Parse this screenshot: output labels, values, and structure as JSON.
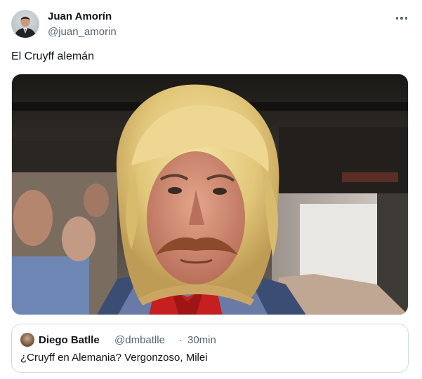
{
  "author": {
    "display_name": "Juan Amorín",
    "handle": "@juan_amorin"
  },
  "menu": {
    "icon": "more-horizontal-icon"
  },
  "tweet": {
    "text": "El Cruyff alemán"
  },
  "quoted_tweet": {
    "display_name": "Diego Batlle",
    "handle": "@dmbatlle",
    "separator": "·",
    "time": "30min",
    "text": "¿Cruyff en Alemania? Vergonzoso, Milei"
  },
  "colors": {
    "text_primary": "#0f1419",
    "text_secondary": "#536471",
    "border": "#cfd9de",
    "background": "#ffffff"
  }
}
